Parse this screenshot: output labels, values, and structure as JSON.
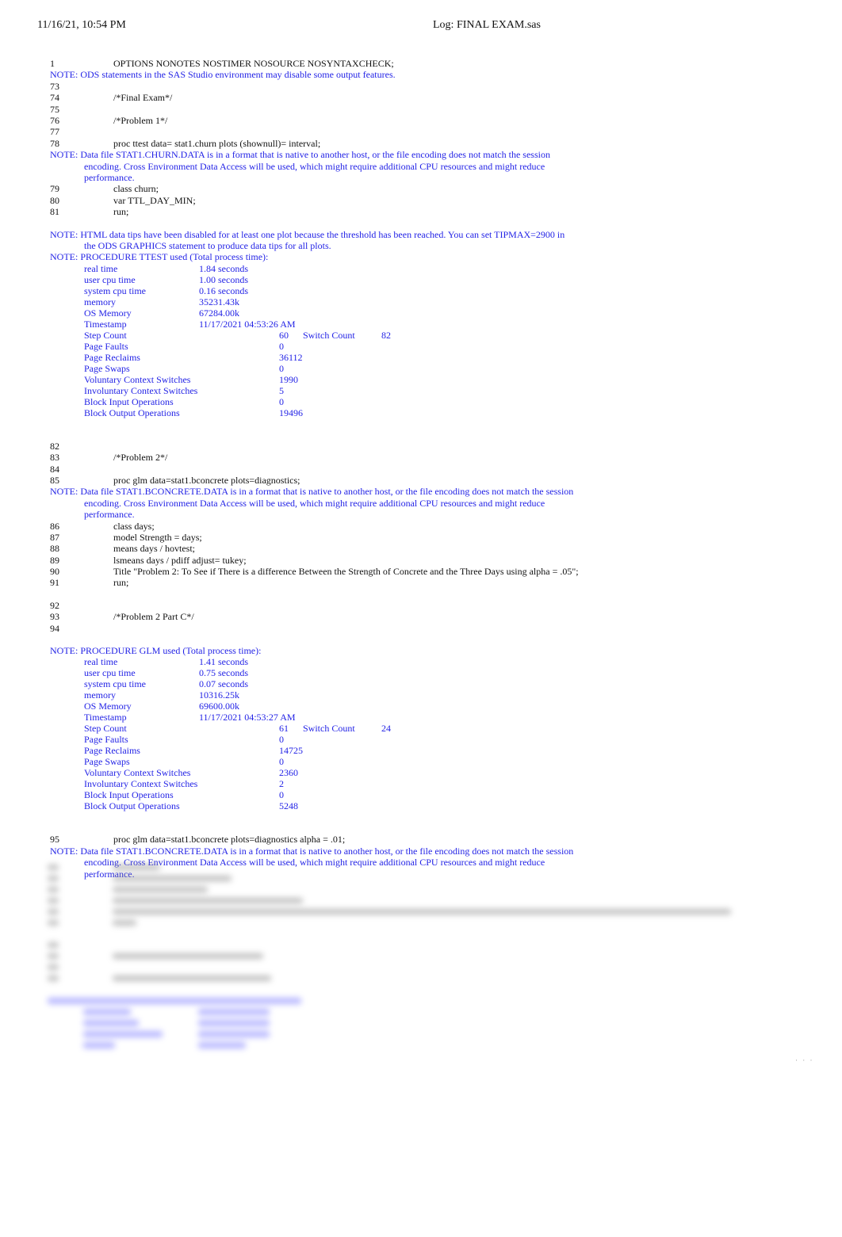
{
  "header": {
    "datetime": "11/16/21, 10:54 PM",
    "title": "Log: FINAL EXAM.sas"
  },
  "colors": {
    "note_text": "#2323e6",
    "code_text": "#111111"
  },
  "log": {
    "line1": {
      "num": "1",
      "code": "OPTIONS NONOTES NOSTIMER NOSOURCE NOSYNTAXCHECK;"
    },
    "note_ods": "NOTE: ODS statements in the SAS Studio environment may disable some output features.",
    "line73": {
      "num": "73",
      "code": ""
    },
    "line74": {
      "num": "74",
      "code": "/*Final Exam*/"
    },
    "line75": {
      "num": "75",
      "code": ""
    },
    "line76": {
      "num": "76",
      "code": "/*Problem 1*/"
    },
    "line77": {
      "num": "77",
      "code": ""
    },
    "line78": {
      "num": "78",
      "code": "proc ttest data= stat1.churn plots (shownull)= interval;"
    },
    "note_churn": {
      "first": "NOTE: Data file STAT1.CHURN.DATA is in a format that is native to another host, or the file encoding does not match the session",
      "second": "encoding. Cross Environment Data Access will be used, which might require additional CPU resources and might reduce",
      "third": "performance."
    },
    "line79": {
      "num": "79",
      "code": "class churn;"
    },
    "line80": {
      "num": "80",
      "code": "var TTL_DAY_MIN;"
    },
    "line81": {
      "num": "81",
      "code": "run;"
    },
    "note_tips": {
      "first": "NOTE: HTML data tips have been disabled for at least one plot because the threshold has been reached. You can set TIPMAX=2900 in",
      "second": "the ODS GRAPHICS statement to produce data tips for all plots."
    },
    "ttest_stats": {
      "heading": "NOTE: PROCEDURE TTEST used (Total process time):",
      "real_time": {
        "label": "real time",
        "value": "1.84 seconds"
      },
      "user_cpu": {
        "label": "user cpu time",
        "value": "1.00 seconds"
      },
      "system_cpu": {
        "label": "system cpu time",
        "value": "0.16 seconds"
      },
      "memory": {
        "label": "memory",
        "value": "35231.43k"
      },
      "os_memory": {
        "label": "OS Memory",
        "value": "67284.00k"
      },
      "timestamp": {
        "label": "Timestamp",
        "value": "11/17/2021 04:53:26 AM"
      },
      "step_count": {
        "label": "Step Count",
        "value": "60",
        "switch_label": "Switch Count",
        "switch_value": "82"
      },
      "page_faults": {
        "label": "Page Faults",
        "value": "0"
      },
      "page_reclaims": {
        "label": "Page Reclaims",
        "value": "36112"
      },
      "page_swaps": {
        "label": "Page Swaps",
        "value": "0"
      },
      "vol_ctx": {
        "label": "Voluntary Context Switches",
        "value": "1990"
      },
      "invol_ctx": {
        "label": "Involuntary Context Switches",
        "value": "5"
      },
      "block_in": {
        "label": "Block Input Operations",
        "value": "0"
      },
      "block_out": {
        "label": "Block Output Operations",
        "value": "19496"
      }
    },
    "line82": {
      "num": "82",
      "code": ""
    },
    "line83": {
      "num": "83",
      "code": "/*Problem 2*/"
    },
    "line84": {
      "num": "84",
      "code": ""
    },
    "line85": {
      "num": "85",
      "code": "proc glm data=stat1.bconcrete plots=diagnostics;"
    },
    "note_bconcrete1": {
      "first": "NOTE: Data file STAT1.BCONCRETE.DATA is in a format that is native to another host, or the file encoding does not match the session",
      "second": "encoding. Cross Environment Data Access will be used, which might require additional CPU resources and might reduce",
      "third": "performance."
    },
    "line86": {
      "num": "86",
      "code": "class days;"
    },
    "line87": {
      "num": "87",
      "code": "model Strength = days;"
    },
    "line88": {
      "num": "88",
      "code": "means days / hovtest;"
    },
    "line89": {
      "num": "89",
      "code": "lsmeans days / pdiff adjust= tukey;"
    },
    "line90": {
      "num": "90",
      "code": "Title \"Problem 2: To See if There is a difference Between the Strength of Concrete and the Three Days using alpha = .05\";"
    },
    "line91": {
      "num": "91",
      "code": "run;"
    },
    "line92": {
      "num": "92",
      "code": ""
    },
    "line93": {
      "num": "93",
      "code": "/*Problem 2 Part C*/"
    },
    "line94": {
      "num": "94",
      "code": ""
    },
    "glm_stats": {
      "heading": "NOTE: PROCEDURE GLM used (Total process time):",
      "real_time": {
        "label": "real time",
        "value": "1.41 seconds"
      },
      "user_cpu": {
        "label": "user cpu time",
        "value": "0.75 seconds"
      },
      "system_cpu": {
        "label": "system cpu time",
        "value": "0.07 seconds"
      },
      "memory": {
        "label": "memory",
        "value": "10316.25k"
      },
      "os_memory": {
        "label": "OS Memory",
        "value": "69600.00k"
      },
      "timestamp": {
        "label": "Timestamp",
        "value": "11/17/2021 04:53:27 AM"
      },
      "step_count": {
        "label": "Step Count",
        "value": "61",
        "switch_label": "Switch Count",
        "switch_value": "24"
      },
      "page_faults": {
        "label": "Page Faults",
        "value": "0"
      },
      "page_reclaims": {
        "label": "Page Reclaims",
        "value": "14725"
      },
      "page_swaps": {
        "label": "Page Swaps",
        "value": "0"
      },
      "vol_ctx": {
        "label": "Voluntary Context Switches",
        "value": "2360"
      },
      "invol_ctx": {
        "label": "Involuntary Context Switches",
        "value": "2"
      },
      "block_in": {
        "label": "Block Input Operations",
        "value": "0"
      },
      "block_out": {
        "label": "Block Output Operations",
        "value": "5248"
      }
    },
    "line95": {
      "num": "95",
      "code": "proc glm data=stat1.bconcrete plots=diagnostics alpha = .01;"
    },
    "note_bconcrete2": {
      "first": "NOTE: Data file STAT1.BCONCRETE.DATA is in a format that is native to another host, or the file encoding does not match the session",
      "second": "encoding. Cross Environment Data Access will be used, which might require additional CPU resources and might reduce",
      "third": "performance."
    }
  },
  "footer": {
    "page_marker": "· · ·"
  }
}
